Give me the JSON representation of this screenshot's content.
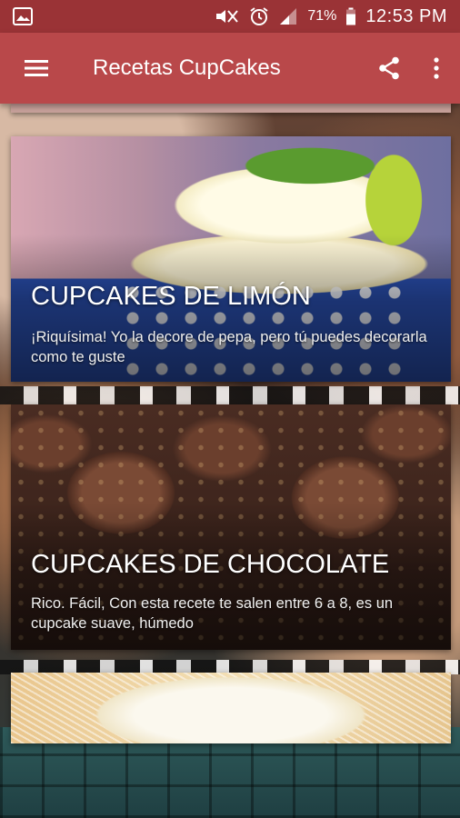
{
  "status_bar": {
    "battery_pct": "71%",
    "time": "12:53 PM",
    "icons": [
      "image-icon",
      "mute-icon",
      "alarm-icon",
      "signal-icon",
      "battery-icon"
    ]
  },
  "toolbar": {
    "title": "Recetas CupCakes",
    "menu_icon": "menu-icon",
    "share_icon": "share-icon",
    "more_icon": "more-vert-icon"
  },
  "colors": {
    "status_bar": "#9a3336",
    "toolbar": "#b9484a",
    "text": "#ffffff"
  },
  "recipes": [
    {
      "title": "CUPCAKES DE LIMÓN",
      "description": "¡Riquísima! Yo la decore de pepa, pero tú puedes decorarla como te guste"
    },
    {
      "title": "CUPCAKES DE CHOCOLATE",
      "description": "Rico. Fácil, Con esta recete te salen entre 6 a 8, es un cupcake suave, húmedo"
    },
    {
      "title": "",
      "description": ""
    }
  ]
}
